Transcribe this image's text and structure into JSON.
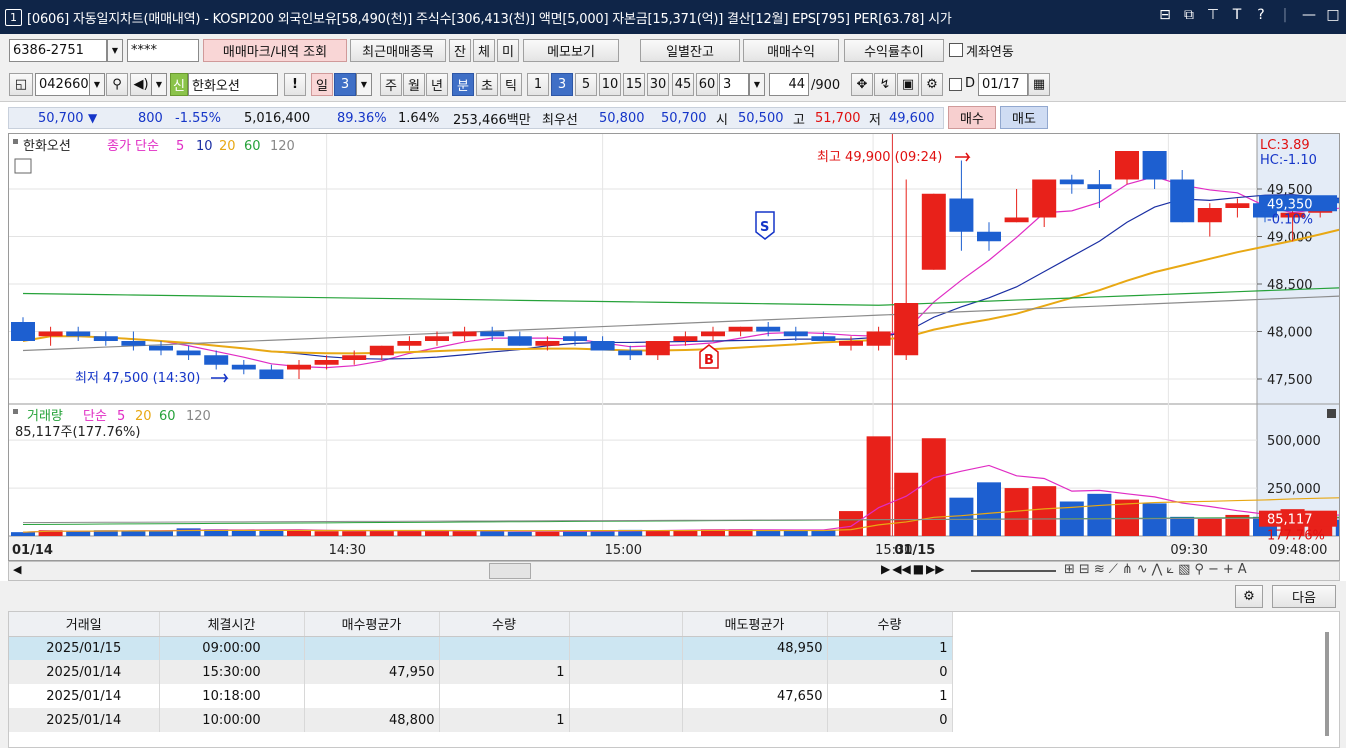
{
  "window": {
    "num": "1",
    "title": "[0606] 자동일지차트(매매내역) - KOSPI200 외국인보유[58,490(천)] 주식수[306,413(천)] 액면[5,000] 자본금[15,371(억)] 결산[12월] EPS[795] PER[63.78] 시가"
  },
  "toolbar1": {
    "account": "6386-2751",
    "password": "****",
    "btn_mark": "매매마크/내역 조회",
    "btn_recent": "최근매매종목",
    "btn_jan": "잔",
    "btn_che": "체",
    "btn_mi": "미",
    "btn_memo": "메모보기",
    "btn_daily": "일별잔고",
    "btn_profit": "매매수익",
    "btn_rate": "수익률추이",
    "chk_link": "계좌연동"
  },
  "toolbar2": {
    "code": "042660",
    "badge": "신",
    "name": "한화오션",
    "excl": "!",
    "period_day": "일",
    "period_num": "3",
    "p_week": "주",
    "p_month": "월",
    "p_year": "년",
    "p_min": "분",
    "p_sec": "초",
    "p_tick": "틱",
    "intervals": [
      "1",
      "3",
      "5",
      "10",
      "15",
      "30",
      "45",
      "60"
    ],
    "interval_sel": "3",
    "count": "44",
    "count_total": "/900",
    "d_label": "D",
    "date": "01/17"
  },
  "quote": {
    "price": "50,700",
    "change": "800",
    "pct": "-1.55%",
    "volume": "5,016,400",
    "vol_ratio": "89.36%",
    "turnover": "1.64%",
    "amount": "253,466백만",
    "best_label": "최우선",
    "ask": "50,800",
    "bid": "50,700",
    "open_label": "시",
    "open": "50,500",
    "high_label": "고",
    "high": "51,700",
    "low_label": "저",
    "low": "49,600",
    "buy": "매수",
    "sell": "매도"
  },
  "chart": {
    "legend_price": {
      "name": "한화오션",
      "main": "종가 단순",
      "ma": [
        "5",
        "10",
        "20",
        "60",
        "120"
      ]
    },
    "legend_vol": {
      "name": "거래량",
      "main": "단순",
      "ma": [
        "5",
        "20",
        "60",
        "120"
      ],
      "value": "85,117주(177.76%)"
    },
    "lc": "LC:3.89",
    "hc": "HC:-1.10",
    "y_ticks": [
      "49,500",
      "49,000",
      "48,500",
      "48,000",
      "47,500"
    ],
    "cur_price": "49,350",
    "cur_pct": "-0.10%",
    "vol_ticks": [
      "500,000",
      "250,000"
    ],
    "cur_vol": "85,117",
    "cur_vol_pct": "177.76%",
    "hi_label": "최고 49,900 (09:24)",
    "lo_label": "최저 47,500 (14:30)",
    "sell_mark": "S",
    "buy_mark": "B",
    "x_labels": [
      "01/14",
      "14:30",
      "15:00",
      "15:30",
      "01/15",
      "09:30",
      "09:48:00"
    ]
  },
  "colors": {
    "up": "#e8211a",
    "down": "#1d5fd0",
    "ma5": "#e02cc4",
    "ma10": "#1b2fa3",
    "ma20": "#e8a814",
    "ma60": "#26a23a",
    "ma120": "#8c8c8c"
  },
  "chart_data": {
    "type": "candlestick",
    "x": [
      "13:57",
      "14:00",
      "14:03",
      "14:06",
      "14:09",
      "14:12",
      "14:15",
      "14:18",
      "14:21",
      "14:24",
      "14:27",
      "14:30",
      "14:33",
      "14:36",
      "14:39",
      "14:42",
      "14:45",
      "14:48",
      "14:51",
      "14:54",
      "14:57",
      "15:00",
      "15:03",
      "15:06",
      "15:09",
      "15:12",
      "15:15",
      "15:18",
      "15:21",
      "15:24",
      "15:27",
      "15:30",
      "09:00",
      "09:03",
      "09:06",
      "09:09",
      "09:12",
      "09:15",
      "09:18",
      "09:21",
      "09:24",
      "09:27",
      "09:30",
      "09:33",
      "09:36",
      "09:39",
      "09:42",
      "09:45",
      "09:48"
    ],
    "ohlc": [
      [
        48100,
        48150,
        47900,
        47900
      ],
      [
        47950,
        48050,
        47850,
        48000
      ],
      [
        48000,
        48050,
        47900,
        47950
      ],
      [
        47950,
        48000,
        47850,
        47900
      ],
      [
        47900,
        48000,
        47800,
        47850
      ],
      [
        47850,
        47900,
        47750,
        47800
      ],
      [
        47800,
        47850,
        47700,
        47750
      ],
      [
        47750,
        47800,
        47600,
        47650
      ],
      [
        47650,
        47700,
        47550,
        47600
      ],
      [
        47600,
        47650,
        47500,
        47500
      ],
      [
        47600,
        47700,
        47500,
        47650
      ],
      [
        47650,
        47750,
        47600,
        47700
      ],
      [
        47700,
        47800,
        47650,
        47750
      ],
      [
        47750,
        47850,
        47700,
        47850
      ],
      [
        47850,
        47950,
        47800,
        47900
      ],
      [
        47900,
        48000,
        47850,
        47950
      ],
      [
        47950,
        48050,
        47900,
        48000
      ],
      [
        48000,
        48050,
        47900,
        47950
      ],
      [
        47950,
        48000,
        47850,
        47850
      ],
      [
        47850,
        47950,
        47800,
        47900
      ],
      [
        47950,
        48000,
        47850,
        47900
      ],
      [
        47900,
        47950,
        47800,
        47800
      ],
      [
        47800,
        47850,
        47700,
        47750
      ],
      [
        47750,
        47900,
        47700,
        47900
      ],
      [
        47900,
        48000,
        47850,
        47950
      ],
      [
        47950,
        48050,
        47900,
        48000
      ],
      [
        48000,
        48050,
        47950,
        48050
      ],
      [
        48050,
        48100,
        47950,
        48000
      ],
      [
        48000,
        48050,
        47900,
        47950
      ],
      [
        47950,
        48000,
        47900,
        47900
      ],
      [
        47850,
        47950,
        47800,
        47900
      ],
      [
        47850,
        48050,
        47800,
        48000
      ],
      [
        47750,
        49600,
        47700,
        48300
      ],
      [
        48650,
        49450,
        48650,
        49450
      ],
      [
        49400,
        49800,
        48850,
        49050
      ],
      [
        49050,
        49150,
        48850,
        48950
      ],
      [
        49150,
        49500,
        49150,
        49200
      ],
      [
        49200,
        49600,
        49100,
        49600
      ],
      [
        49600,
        49650,
        49450,
        49550
      ],
      [
        49550,
        49700,
        49300,
        49500
      ],
      [
        49600,
        49900,
        49550,
        49900
      ],
      [
        49900,
        49900,
        49500,
        49600
      ],
      [
        49600,
        49700,
        49150,
        49150
      ],
      [
        49150,
        49350,
        49000,
        49300
      ],
      [
        49300,
        49400,
        49200,
        49350
      ],
      [
        49350,
        49400,
        49150,
        49200
      ],
      [
        49200,
        49300,
        48950,
        49250
      ],
      [
        49250,
        49400,
        49200,
        49350
      ],
      [
        49400,
        49550,
        49300,
        49350
      ]
    ],
    "volume": [
      20000,
      30000,
      25000,
      30000,
      28000,
      25000,
      40000,
      35000,
      30000,
      30000,
      28000,
      25000,
      25000,
      30000,
      28000,
      28000,
      25000,
      25000,
      22000,
      22000,
      28000,
      30000,
      32000,
      30000,
      30000,
      35000,
      35000,
      30000,
      28000,
      30000,
      130000,
      520000,
      330000,
      510000,
      200000,
      280000,
      250000,
      260000,
      180000,
      220000,
      190000,
      170000,
      100000,
      90000,
      110000,
      100000,
      140000,
      110000,
      85117
    ],
    "trades": [
      {
        "date": "2025/01/15",
        "time": "09:00:00",
        "side": "sell",
        "price": 48950,
        "qty": 1
      },
      {
        "date": "2025/01/14",
        "time": "15:30:00",
        "side": "buy",
        "price": 47950,
        "qty": 1
      },
      {
        "date": "2025/01/14",
        "time": "10:18:00",
        "side": "sell",
        "price": 47650,
        "qty": 1
      },
      {
        "date": "2025/01/14",
        "time": "10:00:00",
        "side": "buy",
        "price": 48800,
        "qty": 1
      }
    ]
  },
  "bottom": {
    "next": "다음",
    "gear": "gear-icon",
    "columns": [
      "거래일",
      "체결시간",
      "매수평균가",
      "수량",
      "",
      "매도평균가",
      "수량"
    ],
    "rows": [
      [
        "2025/01/15",
        "09:00:00",
        "",
        "",
        "",
        "48,950",
        "1"
      ],
      [
        "2025/01/14",
        "15:30:00",
        "47,950",
        "1",
        "",
        "",
        "0"
      ],
      [
        "2025/01/14",
        "10:18:00",
        "",
        "",
        "",
        "47,650",
        "1"
      ],
      [
        "2025/01/14",
        "10:00:00",
        "48,800",
        "1",
        "",
        "",
        "0"
      ]
    ]
  }
}
